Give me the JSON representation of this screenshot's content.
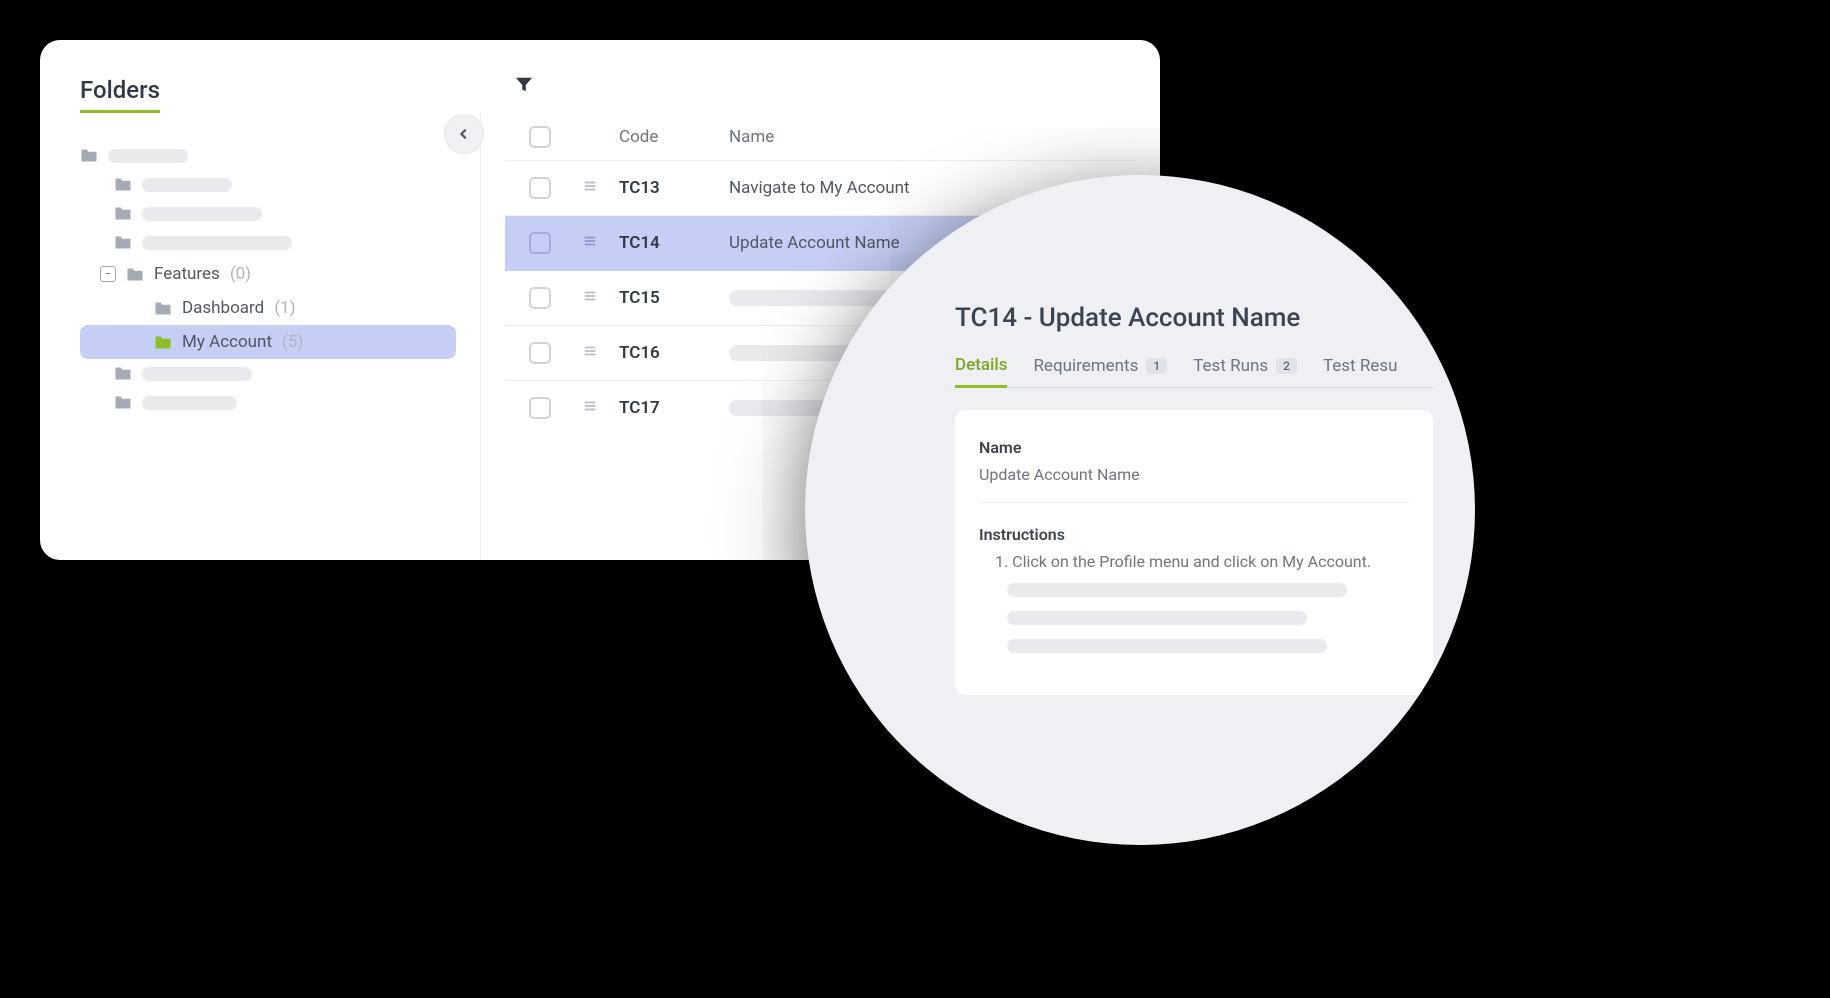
{
  "sidebar": {
    "title": "Folders",
    "tree": {
      "features": {
        "label": "Features",
        "count": "(0)"
      },
      "dashboard": {
        "label": "Dashboard",
        "count": "(1)"
      },
      "my_account": {
        "label": "My Account",
        "count": "(5)"
      }
    }
  },
  "table": {
    "headers": {
      "code": "Code",
      "name": "Name"
    },
    "rows": [
      {
        "code": "TC13",
        "name": "Navigate to My Account",
        "selected": false
      },
      {
        "code": "TC14",
        "name": "Update Account Name",
        "selected": true
      },
      {
        "code": "TC15",
        "name": "",
        "selected": false
      },
      {
        "code": "TC16",
        "name": "",
        "selected": false
      },
      {
        "code": "TC17",
        "name": "",
        "selected": false
      }
    ]
  },
  "detail": {
    "title": "TC14 - Update Account Name",
    "tabs": {
      "details": "Details",
      "requirements": {
        "label": "Requirements",
        "count": "1"
      },
      "test_runs": {
        "label": "Test Runs",
        "count": "2"
      },
      "test_results": "Test Resu"
    },
    "name_label": "Name",
    "name_value": "Update Account Name",
    "instructions_label": "Instructions",
    "instruction_1": "1. Click on the Profile menu and click on My Account."
  }
}
